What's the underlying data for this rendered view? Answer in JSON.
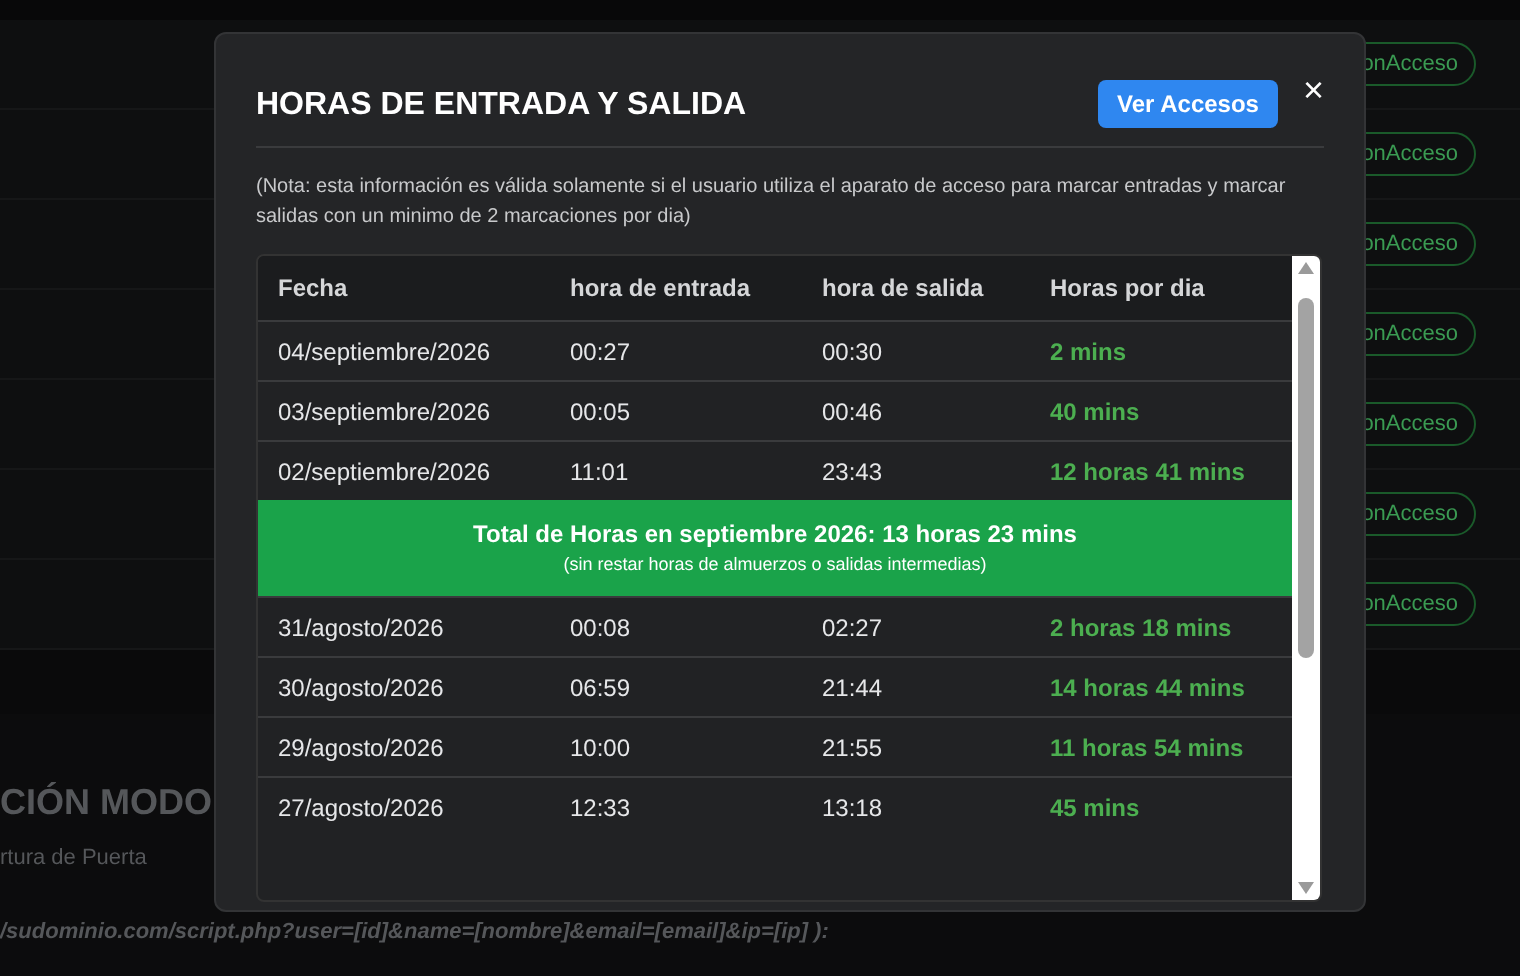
{
  "background": {
    "badges": [
      "onAcceso",
      "onAcceso",
      "onAcceso",
      "onAcceso",
      "onAcceso",
      "onAcceso",
      "onAcceso"
    ],
    "section_title": "CIÓN MODO",
    "section_label": "rtura de Puerta",
    "url": "/sudominio.com/script.php?user=[id]&name=[nombre]&email=[email]&ip=[ip] ):"
  },
  "modal": {
    "title": "HORAS DE ENTRADA Y SALIDA",
    "button": "Ver Accesos",
    "close": "×",
    "note": "(Nota: esta información es válida solamente si el usuario utiliza el aparato de acceso para marcar entradas y marcar salidas con un minimo de 2 marcaciones por dia)",
    "table": {
      "columns": [
        "Fecha",
        "hora de entrada",
        "hora de salida",
        "Horas por dia"
      ],
      "rows": [
        {
          "kind": "day",
          "date": "04/septiembre/2026",
          "in": "00:27",
          "out": "00:30",
          "hours": "2 mins"
        },
        {
          "kind": "day",
          "date": "03/septiembre/2026",
          "in": "00:05",
          "out": "00:46",
          "hours": "40 mins"
        },
        {
          "kind": "day",
          "date": "02/septiembre/2026",
          "in": "11:01",
          "out": "23:43",
          "hours": "12 horas 41 mins"
        },
        {
          "kind": "total",
          "title": "Total de Horas en septiembre 2026: 13 horas 23 mins",
          "subtitle": "(sin restar horas de almuerzos o salidas intermedias)"
        },
        {
          "kind": "day",
          "date": "31/agosto/2026",
          "in": "00:08",
          "out": "02:27",
          "hours": "2 horas 18 mins"
        },
        {
          "kind": "day",
          "date": "30/agosto/2026",
          "in": "06:59",
          "out": "21:44",
          "hours": "14 horas 44 mins"
        },
        {
          "kind": "day",
          "date": "29/agosto/2026",
          "in": "10:00",
          "out": "21:55",
          "hours": "11 horas 54 mins"
        },
        {
          "kind": "day",
          "date": "27/agosto/2026",
          "in": "12:33",
          "out": "13:18",
          "hours": "45 mins"
        }
      ]
    }
  }
}
